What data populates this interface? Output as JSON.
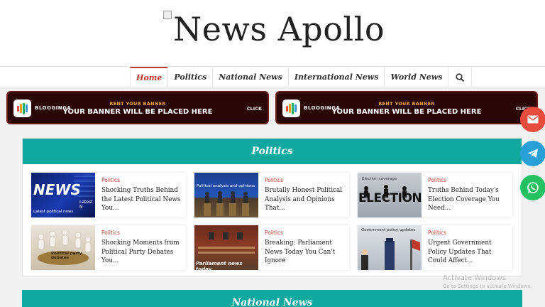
{
  "site": {
    "title": "News Apollo"
  },
  "nav": {
    "items": [
      {
        "label": "Home",
        "active": true
      },
      {
        "label": "Politics"
      },
      {
        "label": "National News"
      },
      {
        "label": "International News"
      },
      {
        "label": "World News"
      }
    ],
    "search_icon": "search-icon"
  },
  "banners": [
    {
      "brand": "BLOOGINGA",
      "top_text": "RENT YOUR BANNER",
      "main_text": "YOUR BANNER WILL BE PLACED HERE",
      "click": "CLICK"
    },
    {
      "brand": "BLOOGINGA",
      "top_text": "RENT YOUR BANNER",
      "main_text": "YOUR BANNER WILL BE PLACED HERE",
      "click": "CLICK"
    }
  ],
  "politics": {
    "heading": "Politics",
    "cards": [
      {
        "category": "Politics",
        "title": "Shocking Truths Behind the Latest Political News You...",
        "thumb_text": "Latest political news",
        "thumb_big": "NEWS",
        "thumb_side": "Latest N"
      },
      {
        "category": "Politics",
        "title": "Brutally Honest Political Analysis and Opinions That...",
        "thumb_text": "Political analysis and opinions"
      },
      {
        "category": "Politics",
        "title": "Truths Behind Today's Election Coverage You Need...",
        "thumb_text": "Election coverage",
        "thumb_big": "ELECTION"
      },
      {
        "category": "Politics",
        "title": "Shocking Moments from Political Party Debates You...",
        "thumb_text": "Political party debates"
      },
      {
        "category": "Politics",
        "title": "Breaking: Parliament News Today You Can't Ignore",
        "thumb_text": "Parliament news today"
      },
      {
        "category": "Politics",
        "title": "Urgent Government Policy Updates That Could Affect...",
        "thumb_text": "Government policy updates"
      }
    ]
  },
  "national": {
    "heading": "National News"
  },
  "share": [
    {
      "icon": "email-icon",
      "color": "#e74c3c"
    },
    {
      "icon": "telegram-icon",
      "color": "#2a9fd6"
    },
    {
      "icon": "whatsapp-icon",
      "color": "#25c064"
    }
  ],
  "watermark": {
    "line1": "Activate Windows",
    "line2": "Go to Settings to activate Windows."
  },
  "colors": {
    "accent": "#c0392b",
    "section_head": "#11a8a0",
    "banner_bg": "#2a0606"
  }
}
